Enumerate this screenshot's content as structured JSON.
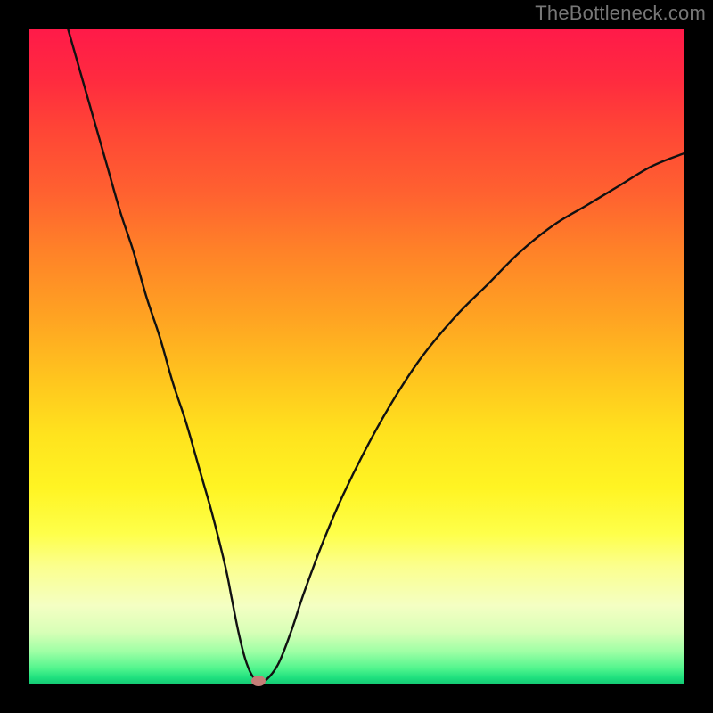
{
  "watermark": "TheBottleneck.com",
  "colors": {
    "top": "#ff1a49",
    "mid": "#ffe31e",
    "bottom": "#14c773",
    "curve": "#111111",
    "marker": "#c57d77",
    "background": "#000000"
  },
  "chart_data": {
    "type": "line",
    "title": "",
    "xlabel": "",
    "ylabel": "",
    "xlim": [
      0,
      100
    ],
    "ylim": [
      0,
      100
    ],
    "series": [
      {
        "name": "bottleneck-curve",
        "x": [
          6,
          8,
          10,
          12,
          14,
          16,
          18,
          20,
          22,
          24,
          26,
          28,
          30,
          31,
          32,
          33,
          34,
          35,
          36,
          38,
          40,
          42,
          45,
          48,
          52,
          56,
          60,
          65,
          70,
          75,
          80,
          85,
          90,
          95,
          100
        ],
        "y": [
          100,
          93,
          86,
          79,
          72,
          66,
          59,
          53,
          46,
          40,
          33,
          26,
          18,
          13,
          8,
          4,
          1.5,
          0.5,
          0.5,
          3,
          8,
          14,
          22,
          29,
          37,
          44,
          50,
          56,
          61,
          66,
          70,
          73,
          76,
          79,
          81
        ]
      }
    ],
    "marker": {
      "x": 35,
      "y": 0.5,
      "name": "optimal-point"
    },
    "gradient_meaning": "red=high bottleneck (100%), green=no bottleneck (0%)"
  }
}
